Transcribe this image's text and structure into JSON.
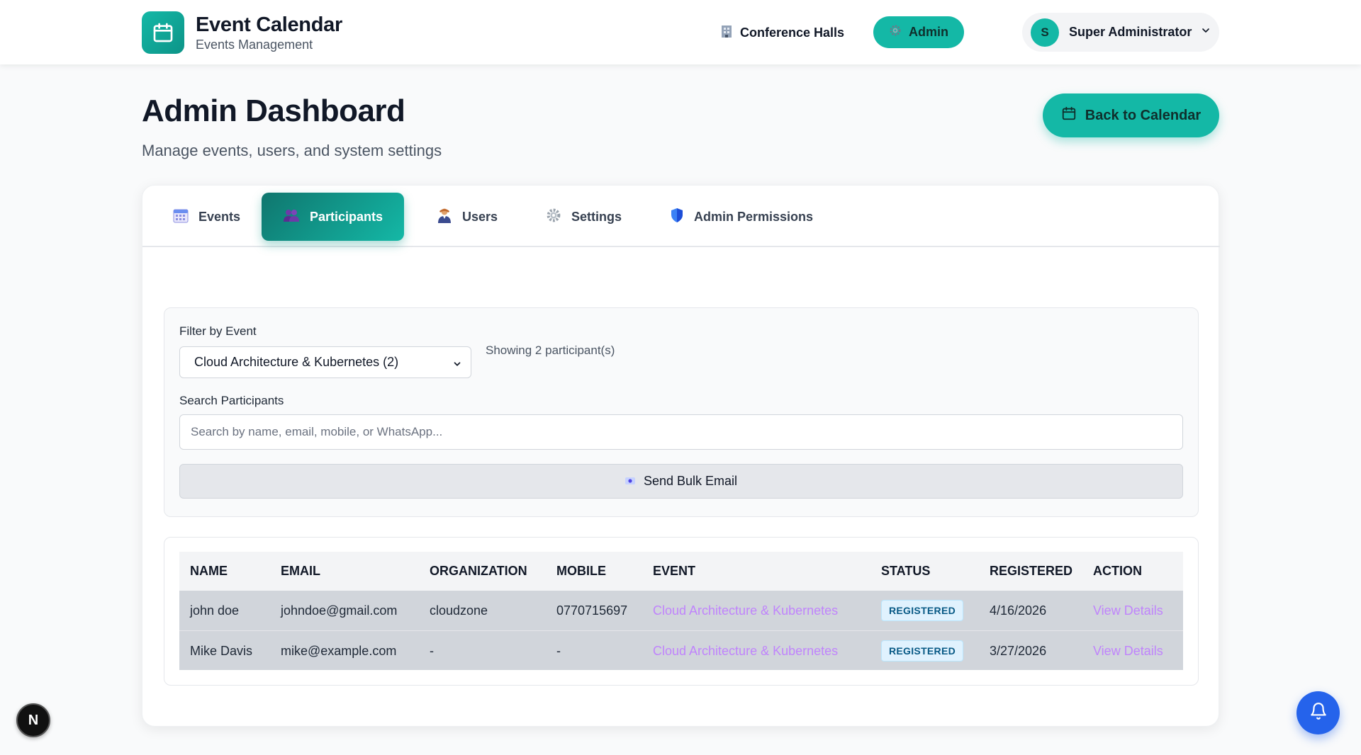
{
  "header": {
    "app_title": "Event Calendar",
    "app_subtitle": "Events Management",
    "nav": {
      "conference_halls": "Conference Halls",
      "admin": "Admin"
    },
    "user": {
      "initial": "S",
      "name": "Super Administrator"
    }
  },
  "page": {
    "title": "Admin Dashboard",
    "subtitle": "Manage events, users, and system settings",
    "back_button": "Back to Calendar"
  },
  "tabs": [
    {
      "label": "Events",
      "icon": "calendar-icon"
    },
    {
      "label": "Participants",
      "icon": "people-icon",
      "active": true
    },
    {
      "label": "Users",
      "icon": "user-icon"
    },
    {
      "label": "Settings",
      "icon": "gear-icon"
    },
    {
      "label": "Admin Permissions",
      "icon": "shield-icon"
    }
  ],
  "filters": {
    "event_label": "Filter by Event",
    "event_selected": "Cloud Architecture & Kubernetes (2)",
    "showing_text": "Showing 2 participant(s)",
    "search_label": "Search Participants",
    "search_placeholder": "Search by name, email, mobile, or WhatsApp...",
    "bulk_email_button": "Send Bulk Email"
  },
  "table": {
    "columns": [
      "NAME",
      "EMAIL",
      "ORGANIZATION",
      "MOBILE",
      "EVENT",
      "STATUS",
      "REGISTERED",
      "ACTION"
    ],
    "rows": [
      {
        "name": "john doe",
        "email": "johndoe@gmail.com",
        "organization": "cloudzone",
        "mobile": "0770715697",
        "event": "Cloud Architecture & Kubernetes",
        "status": "REGISTERED",
        "registered": "4/16/2026",
        "action": "View Details"
      },
      {
        "name": "Mike Davis",
        "email": "mike@example.com",
        "organization": "-",
        "mobile": "-",
        "event": "Cloud Architecture & Kubernetes",
        "status": "REGISTERED",
        "registered": "3/27/2026",
        "action": "View Details"
      }
    ]
  },
  "floating": {
    "dev_badge": "N"
  },
  "colors": {
    "accent": "#14b8a6",
    "accent_dark": "#0f766e",
    "link": "#c084fc",
    "bell": "#2563eb"
  }
}
